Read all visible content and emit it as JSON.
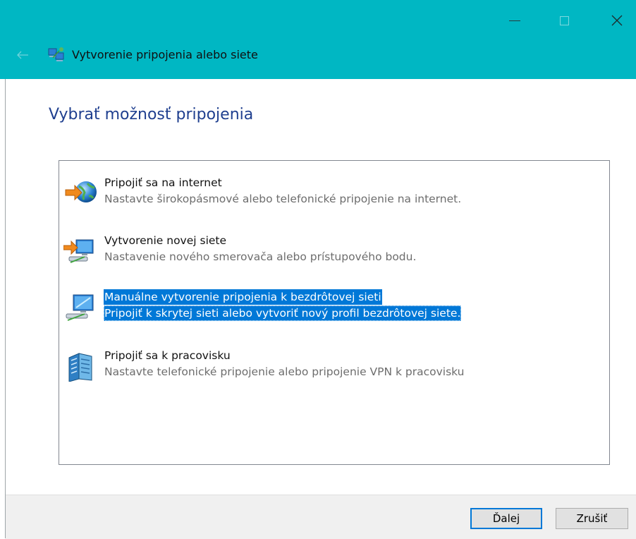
{
  "window": {
    "title": "Vytvorenie pripojenia alebo siete",
    "accent_color": "#00b7c3",
    "controls": {
      "minimize": "minimize-icon",
      "maximize": "maximize-icon",
      "close": "close-icon",
      "back": "back-arrow-icon"
    }
  },
  "page": {
    "heading": "Vybrať možnosť pripojenia"
  },
  "options": [
    {
      "title": "Pripojiť sa na internet",
      "description": "Nastavte širokopásmové alebo telefonické pripojenie na internet.",
      "icon": "globe-connect-icon",
      "selected": false
    },
    {
      "title": "Vytvorenie novej siete",
      "description": "Nastavenie nového smerovača alebo prístupového bodu.",
      "icon": "new-network-icon",
      "selected": false
    },
    {
      "title": "Manuálne vytvorenie pripojenia k bezdrôtovej sieti",
      "description": "Pripojiť k skrytej sieti alebo vytvoriť nový profil bezdrôtovej siete.",
      "icon": "wireless-network-icon",
      "selected": true
    },
    {
      "title": "Pripojiť sa k pracovisku",
      "description": "Nastavte telefonické pripojenie alebo pripojenie VPN k pracovisku",
      "icon": "workplace-vpn-icon",
      "selected": false
    }
  ],
  "footer": {
    "next_label": "Ďalej",
    "cancel_label": "Zrušiť"
  },
  "colors": {
    "selection": "#0078d7",
    "heading": "#1f3f8f"
  }
}
